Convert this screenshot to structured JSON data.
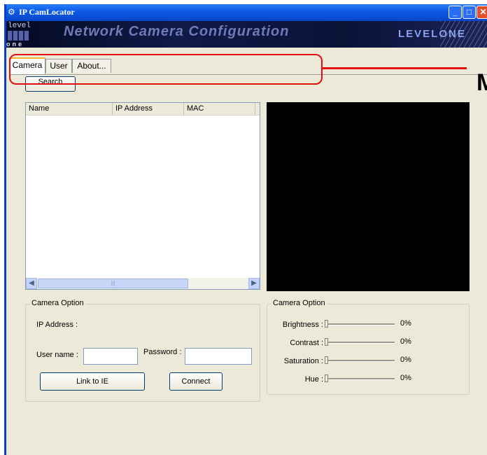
{
  "window": {
    "title": "IP CamLocator"
  },
  "banner": {
    "logo_top": "level",
    "logo_bottom": "one",
    "title": "Network Camera Configuration",
    "brand": "LEVELONE"
  },
  "tabs": [
    {
      "label": "Camera",
      "active": true
    },
    {
      "label": "User",
      "active": false
    },
    {
      "label": "About...",
      "active": false
    }
  ],
  "toolbar": {
    "search_label": "Search"
  },
  "camera_list": {
    "columns": [
      "Name",
      "IP Address",
      "MAC"
    ],
    "rows": []
  },
  "camera_option_left": {
    "title": "Camera Option",
    "ip_label": "IP Address :",
    "username_label": "User name :",
    "username_value": "",
    "password_label": "Password :",
    "password_value": "",
    "link_button": "Link to IE",
    "connect_button": "Connect"
  },
  "camera_option_right": {
    "title": "Camera Option",
    "sliders": [
      {
        "label": "Brightness :",
        "value": "0%",
        "level": 0
      },
      {
        "label": "Contrast :",
        "value": "0%",
        "level": 0
      },
      {
        "label": "Saturation :",
        "value": "0%",
        "level": 0
      },
      {
        "label": "Hue :",
        "value": "0%",
        "level": 0
      }
    ]
  },
  "annotation": {
    "letter": "M"
  },
  "colors": {
    "titlebar": "#0a58e6",
    "annotation": "#e01010",
    "window_bg": "#ece9d8",
    "video_bg": "#000000"
  }
}
